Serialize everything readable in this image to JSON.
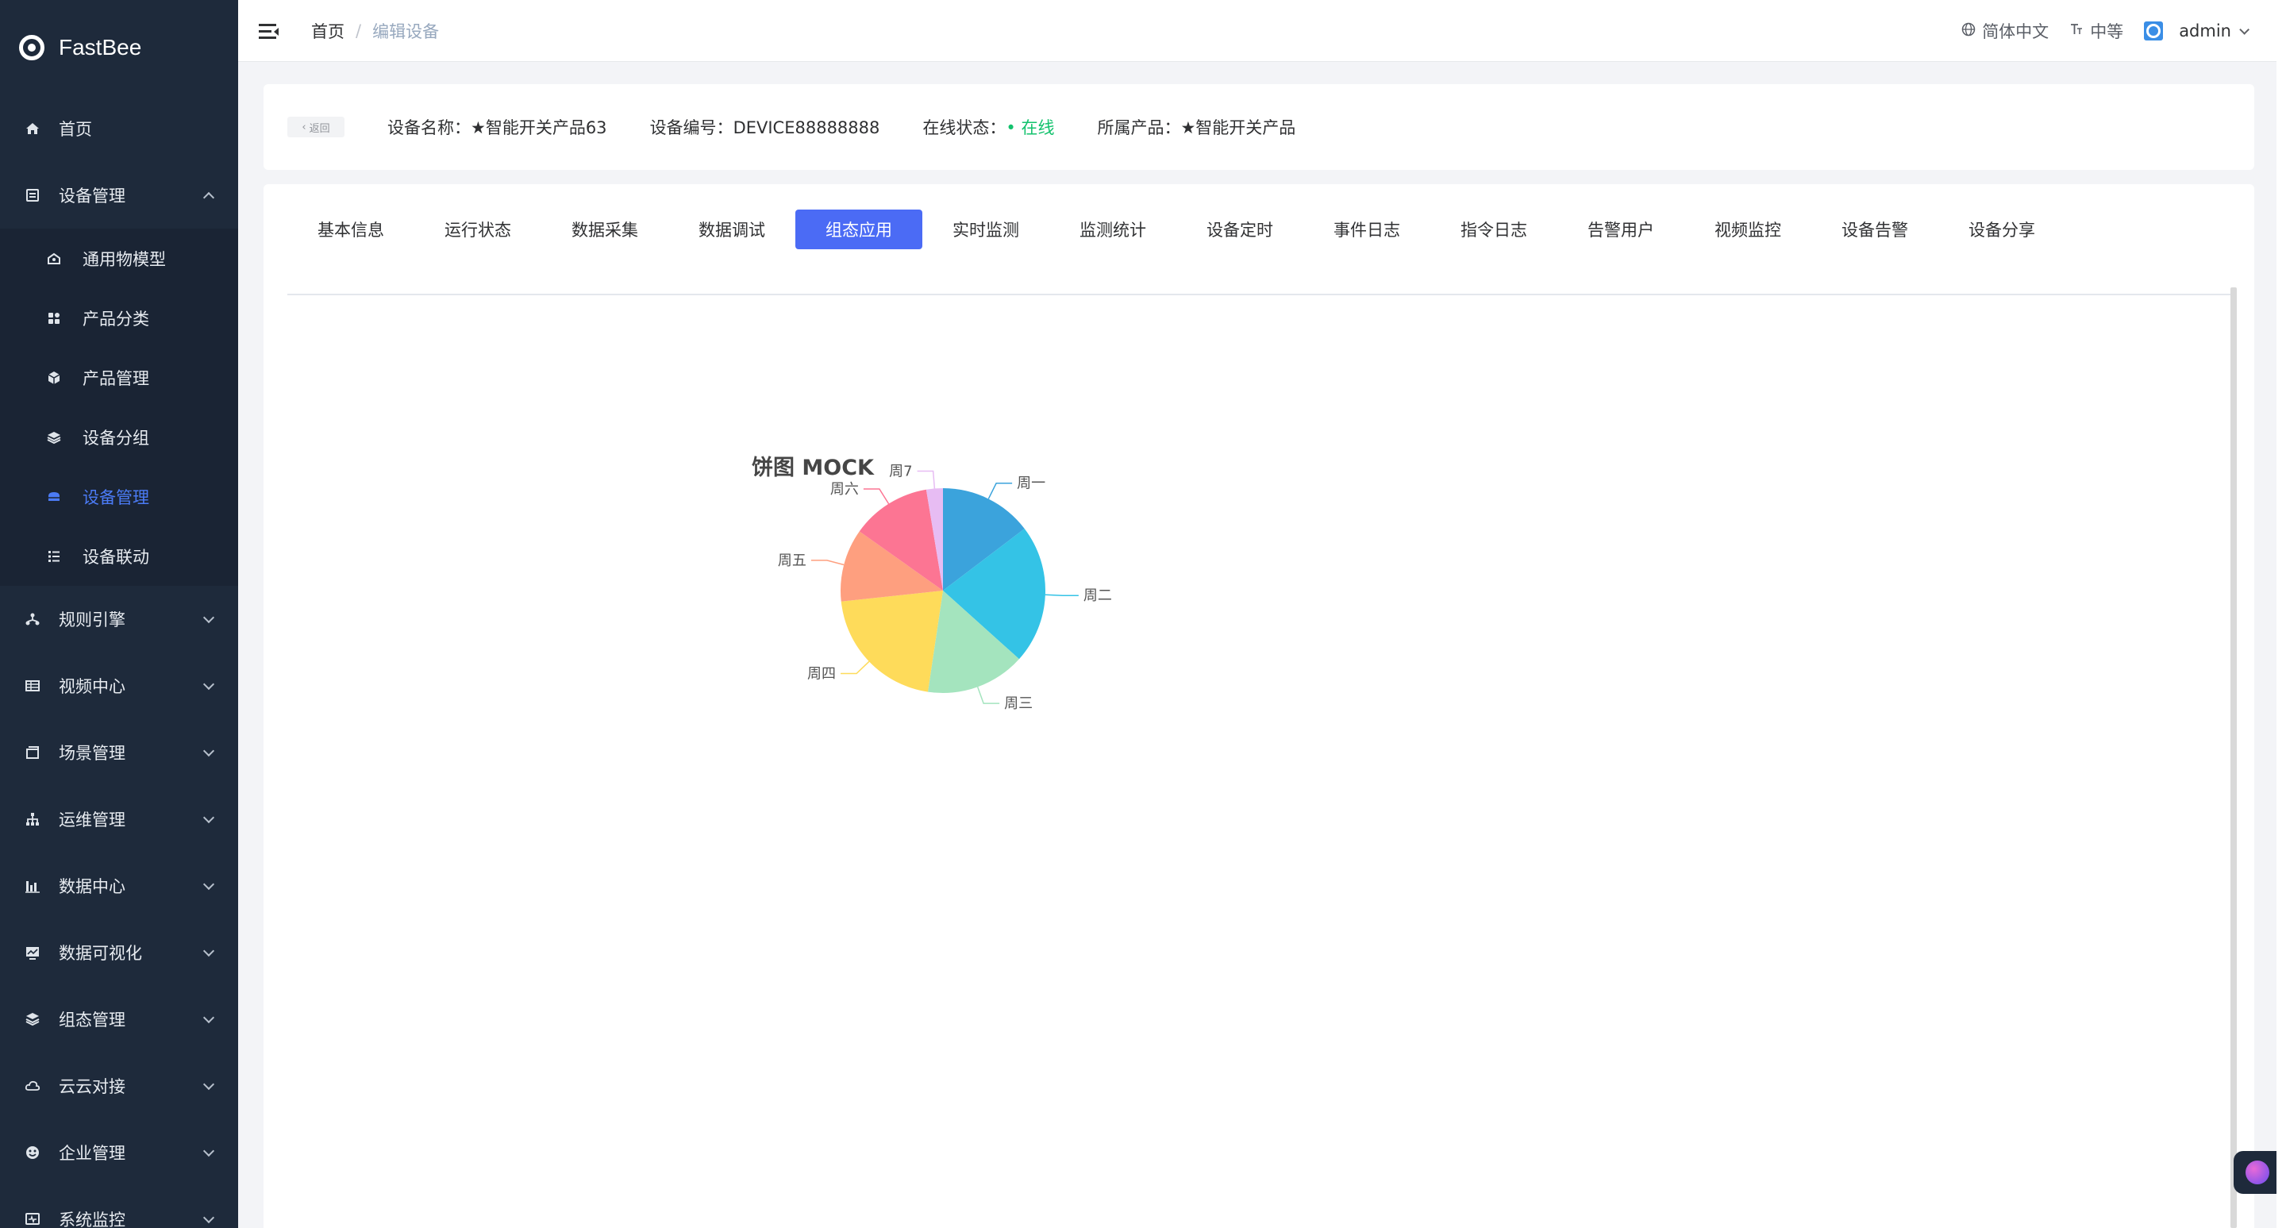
{
  "app": {
    "name": "FastBee"
  },
  "sidebar": {
    "items": [
      {
        "label": "首页",
        "icon": "home-icon"
      },
      {
        "label": "设备管理",
        "icon": "device-icon",
        "expanded": true,
        "children": [
          {
            "label": "通用物模型",
            "icon": "model-icon"
          },
          {
            "label": "产品分类",
            "icon": "category-icon"
          },
          {
            "label": "产品管理",
            "icon": "product-icon"
          },
          {
            "label": "设备分组",
            "icon": "layers-icon"
          },
          {
            "label": "设备管理",
            "icon": "device-manage-icon",
            "active": true
          },
          {
            "label": "设备联动",
            "icon": "linkage-icon"
          }
        ]
      },
      {
        "label": "规则引擎",
        "icon": "rule-icon"
      },
      {
        "label": "视频中心",
        "icon": "video-icon"
      },
      {
        "label": "场景管理",
        "icon": "scene-icon"
      },
      {
        "label": "运维管理",
        "icon": "ops-icon"
      },
      {
        "label": "数据中心",
        "icon": "data-icon"
      },
      {
        "label": "数据可视化",
        "icon": "visual-icon"
      },
      {
        "label": "组态管理",
        "icon": "config-icon"
      },
      {
        "label": "云云对接",
        "icon": "cloud-icon"
      },
      {
        "label": "企业管理",
        "icon": "enterprise-icon"
      },
      {
        "label": "系统监控",
        "icon": "monitor-icon"
      }
    ]
  },
  "header": {
    "breadcrumb": [
      "首页",
      "编辑设备"
    ],
    "breadcrumb_sep": "/",
    "language": "简体中文",
    "size": "中等",
    "user": "admin"
  },
  "device": {
    "back_label": "返回",
    "name_label": "设备名称：",
    "name": "★智能开关产品63",
    "serial_label": "设备编号：",
    "serial": "DEVICE88888888",
    "status_label": "在线状态：",
    "status": "• 在线",
    "product_label": "所属产品：",
    "product": "★智能开关产品",
    "status_color": "#13c26d"
  },
  "tabs": [
    {
      "label": "基本信息"
    },
    {
      "label": "运行状态"
    },
    {
      "label": "数据采集"
    },
    {
      "label": "数据调试"
    },
    {
      "label": "组态应用",
      "active": true
    },
    {
      "label": "实时监测"
    },
    {
      "label": "监测统计"
    },
    {
      "label": "设备定时"
    },
    {
      "label": "事件日志"
    },
    {
      "label": "指令日志"
    },
    {
      "label": "告警用户"
    },
    {
      "label": "视频监控"
    },
    {
      "label": "设备告警"
    },
    {
      "label": "设备分享"
    }
  ],
  "colors": {
    "accent": "#4b6bf5",
    "sidebar_bg": "#1e2a3b",
    "active_menu": "#4b7bf5"
  },
  "chart_data": {
    "type": "pie",
    "title": "饼图 MOCK",
    "categories": [
      "周一",
      "周二",
      "周三",
      "周四",
      "周五",
      "周六",
      "周7"
    ],
    "values": [
      14,
      21,
      15,
      20,
      11,
      12,
      2.5
    ],
    "colors": [
      "#3ba3dc",
      "#34c3e6",
      "#a4e4be",
      "#fedb5a",
      "#fe9f7f",
      "#fc7593",
      "#e7bcf3"
    ],
    "legend": "none"
  }
}
